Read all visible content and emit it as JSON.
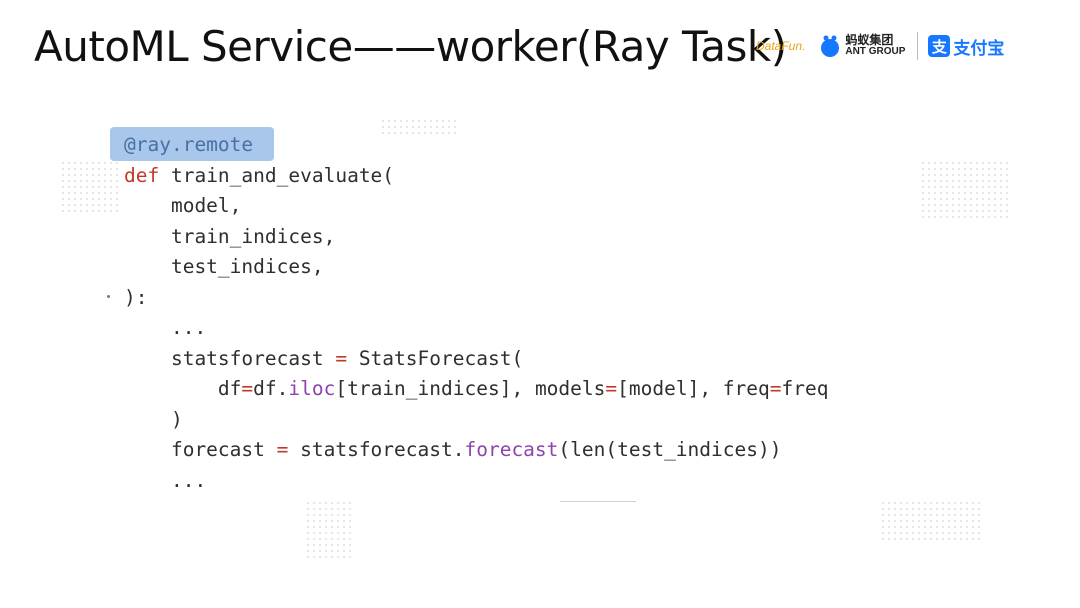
{
  "slide": {
    "title": "AutoML Service——worker(Ray Task)"
  },
  "logos": {
    "datafun": "DataFun.",
    "ant_cn": "蚂蚁集团",
    "ant_en": "ANT GROUP",
    "alipay_mark": "支",
    "alipay_text": "支付宝",
    "ant_icon": "ant-group-logo-icon",
    "alipay_icon": "alipay-logo-icon",
    "brand_color": "#1677ff"
  },
  "code": {
    "decorator": "@ray.remote",
    "l2_kw": "def",
    "l2_rest": " train_and_evaluate(",
    "l3": "    model,",
    "l4": "    train_indices,",
    "l5": "    test_indices,",
    "l6": "):",
    "l7": "    ...",
    "l8_a": "    statsforecast ",
    "l8_op": "=",
    "l8_b": " StatsForecast(",
    "l9_a": "        df",
    "l9_op1": "=",
    "l9_b": "df.",
    "l9_fn": "iloc",
    "l9_c": "[train_indices], models",
    "l9_op2": "=",
    "l9_d": "[model], freq",
    "l9_op3": "=",
    "l9_e": "freq",
    "l10": "    )",
    "l11_a": "    forecast ",
    "l11_op": "=",
    "l11_b": " statsforecast.",
    "l11_fn": "forecast",
    "l11_c": "(len(test_indices))",
    "l12": "    ..."
  }
}
